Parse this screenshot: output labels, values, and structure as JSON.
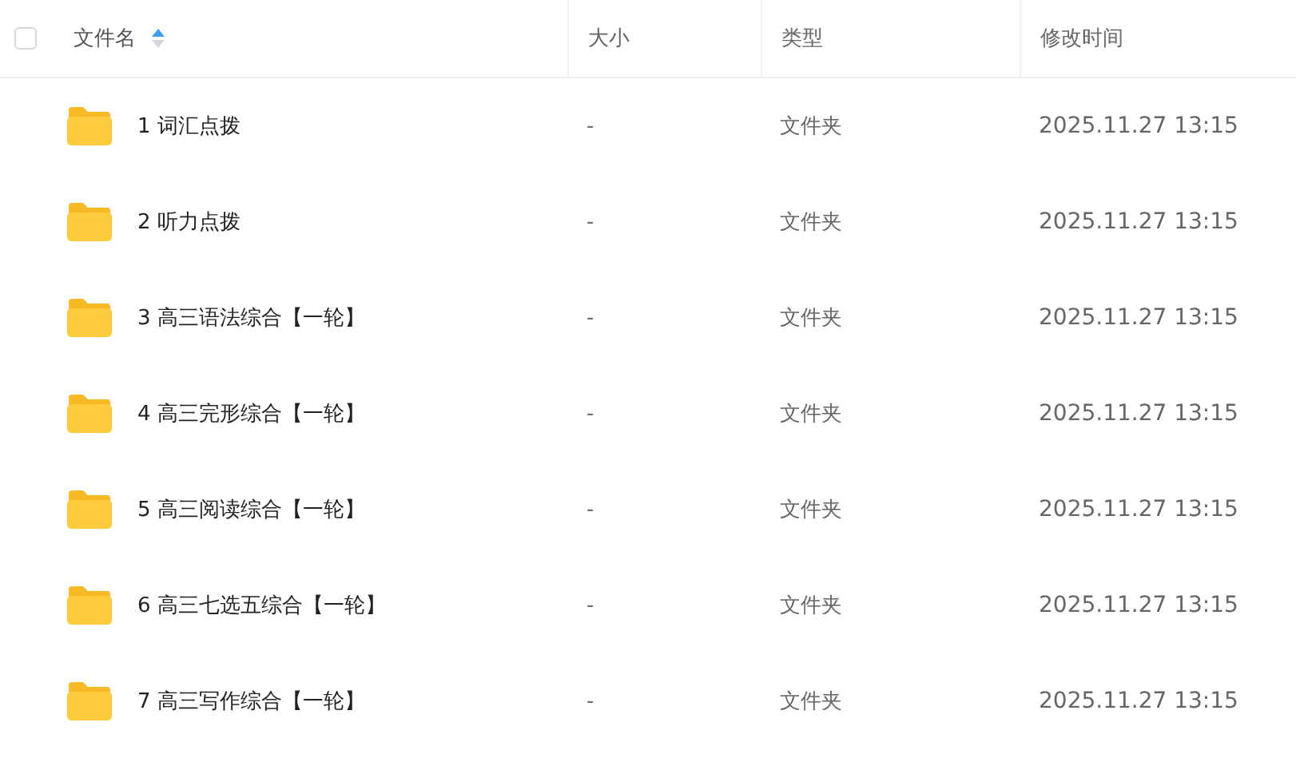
{
  "header": {
    "checked": false,
    "ascending": true,
    "columns": [
      {
        "label": "文件名",
        "sorted": true
      },
      {
        "label": "大小",
        "sorted": false
      },
      {
        "label": "类型",
        "sorted": false
      },
      {
        "label": "修改时间",
        "sorted": false
      }
    ]
  },
  "rows": [
    {
      "name": "1 词汇点拨",
      "size": "-",
      "type": "文件夹",
      "modified": "2025.11.27 13:15"
    },
    {
      "name": "2 听力点拨",
      "size": "-",
      "type": "文件夹",
      "modified": "2025.11.27 13:15"
    },
    {
      "name": "3 高三语法综合【一轮】",
      "size": "-",
      "type": "文件夹",
      "modified": "2025.11.27 13:15"
    },
    {
      "name": "4 高三完形综合【一轮】",
      "size": "-",
      "type": "文件夹",
      "modified": "2025.11.27 13:15"
    },
    {
      "name": "5 高三阅读综合【一轮】",
      "size": "-",
      "type": "文件夹",
      "modified": "2025.11.27 13:15"
    },
    {
      "name": "6 高三七选五综合【一轮】",
      "size": "-",
      "type": "文件夹",
      "modified": "2025.11.27 13:15"
    },
    {
      "name": "7 高三写作综合【一轮】",
      "size": "-",
      "type": "文件夹",
      "modified": "2025.11.27 13:15"
    }
  ]
}
